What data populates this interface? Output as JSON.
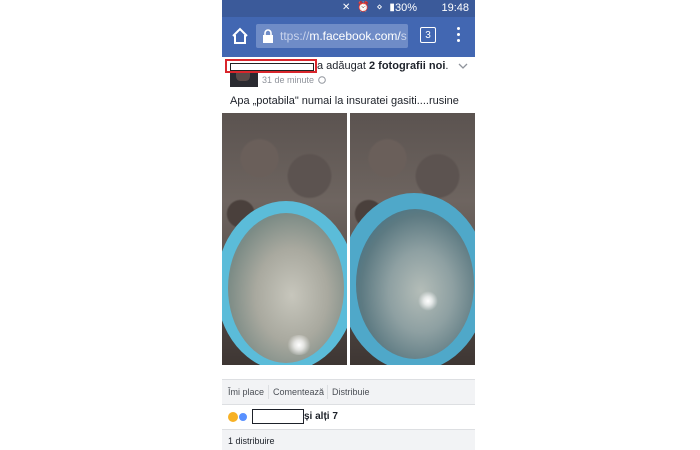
{
  "status_bar": {
    "glyphs": "✕ ⏰ ⋄ ▮",
    "battery_pct": "30%",
    "time": "19:48"
  },
  "browser": {
    "url_prefix": "ttps://",
    "url_host": "m.facebook.com/",
    "url_suffix": "s",
    "tab_count": "3"
  },
  "post": {
    "action_text": "a adăugat ",
    "action_bold": "2 fotografii noi",
    "action_end": ".",
    "time": "31 de minute",
    "text": "Apa „potabila\" numai la insuratei gasiti....rusine"
  },
  "actions": {
    "like": "Îmi place",
    "comment": "Comentează",
    "share": "Distribuie"
  },
  "reactions": {
    "others": "și alți 7"
  },
  "shares": {
    "count_text": "1 distribuire"
  }
}
